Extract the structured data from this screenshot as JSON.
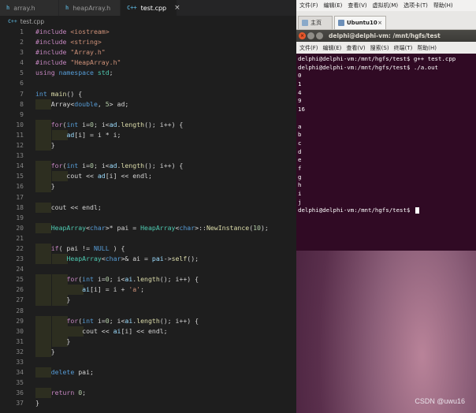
{
  "editor": {
    "tabs": [
      {
        "icon": "h",
        "label": "array.h",
        "active": false
      },
      {
        "icon": "h",
        "label": "heapArray.h",
        "active": false
      },
      {
        "icon": "C++",
        "label": "test.cpp",
        "active": true,
        "close": "×"
      }
    ],
    "breadcrumb": {
      "icon": "C++",
      "label": "test.cpp"
    },
    "line_numbers": [
      "1",
      "2",
      "3",
      "4",
      "5",
      "6",
      "7",
      "8",
      "9",
      "10",
      "11",
      "12",
      "13",
      "14",
      "15",
      "16",
      "17",
      "18",
      "19",
      "20",
      "21",
      "22",
      "23",
      "24",
      "25",
      "26",
      "27",
      "28",
      "29",
      "30",
      "31",
      "32",
      "33",
      "34",
      "35",
      "36",
      "37"
    ],
    "code": [
      [
        {
          "c": "pp",
          "t": "#include "
        },
        {
          "c": "str",
          "t": "<iostream>"
        }
      ],
      [
        {
          "c": "pp",
          "t": "#include "
        },
        {
          "c": "str",
          "t": "<string>"
        }
      ],
      [
        {
          "c": "pp",
          "t": "#include "
        },
        {
          "c": "str",
          "t": "\"Array.h\""
        }
      ],
      [
        {
          "c": "pp",
          "t": "#include "
        },
        {
          "c": "str",
          "t": "\"HeapArray.h\""
        }
      ],
      [
        {
          "c": "ctl",
          "t": "using "
        },
        {
          "c": "kw",
          "t": "namespace "
        },
        {
          "c": "ty",
          "t": "std"
        },
        {
          "c": "pl",
          "t": ";"
        }
      ],
      [],
      [
        {
          "c": "kw",
          "t": "int "
        },
        {
          "c": "fn",
          "t": "main"
        },
        {
          "c": "pl",
          "t": "() {"
        }
      ],
      [
        {
          "c": "pl",
          "t": "    Array<"
        },
        {
          "c": "kw",
          "t": "double"
        },
        {
          "c": "pl",
          "t": ", "
        },
        {
          "c": "num",
          "t": "5"
        },
        {
          "c": "pl",
          "t": "> ad;"
        }
      ],
      [],
      [
        {
          "c": "pl",
          "t": "    "
        },
        {
          "c": "ctl",
          "t": "for"
        },
        {
          "c": "pl",
          "t": "("
        },
        {
          "c": "kw",
          "t": "int "
        },
        {
          "c": "pl",
          "t": "i="
        },
        {
          "c": "num",
          "t": "0"
        },
        {
          "c": "pl",
          "t": "; i<"
        },
        {
          "c": "var",
          "t": "ad"
        },
        {
          "c": "pl",
          "t": "."
        },
        {
          "c": "fn",
          "t": "length"
        },
        {
          "c": "pl",
          "t": "(); i++) {"
        }
      ],
      [
        {
          "c": "pl",
          "t": "        "
        },
        {
          "c": "var",
          "t": "ad"
        },
        {
          "c": "pl",
          "t": "[i] = i * i;"
        }
      ],
      [
        {
          "c": "pl",
          "t": "    }"
        }
      ],
      [],
      [
        {
          "c": "pl",
          "t": "    "
        },
        {
          "c": "ctl",
          "t": "for"
        },
        {
          "c": "pl",
          "t": "("
        },
        {
          "c": "kw",
          "t": "int "
        },
        {
          "c": "pl",
          "t": "i="
        },
        {
          "c": "num",
          "t": "0"
        },
        {
          "c": "pl",
          "t": "; i<"
        },
        {
          "c": "var",
          "t": "ad"
        },
        {
          "c": "pl",
          "t": "."
        },
        {
          "c": "fn",
          "t": "length"
        },
        {
          "c": "pl",
          "t": "(); i++) {"
        }
      ],
      [
        {
          "c": "pl",
          "t": "        cout << "
        },
        {
          "c": "var",
          "t": "ad"
        },
        {
          "c": "pl",
          "t": "[i] << endl;"
        }
      ],
      [
        {
          "c": "pl",
          "t": "    }"
        }
      ],
      [],
      [
        {
          "c": "pl",
          "t": "    cout << endl;"
        }
      ],
      [],
      [
        {
          "c": "pl",
          "t": "    "
        },
        {
          "c": "ty",
          "t": "HeapArray"
        },
        {
          "c": "pl",
          "t": "<"
        },
        {
          "c": "kw",
          "t": "char"
        },
        {
          "c": "pl",
          "t": ">* pai = "
        },
        {
          "c": "ty",
          "t": "HeapArray"
        },
        {
          "c": "pl",
          "t": "<"
        },
        {
          "c": "kw",
          "t": "char"
        },
        {
          "c": "pl",
          "t": ">::"
        },
        {
          "c": "fn",
          "t": "NewInstance"
        },
        {
          "c": "pl",
          "t": "("
        },
        {
          "c": "num",
          "t": "10"
        },
        {
          "c": "pl",
          "t": ");"
        }
      ],
      [],
      [
        {
          "c": "pl",
          "t": "    "
        },
        {
          "c": "ctl",
          "t": "if"
        },
        {
          "c": "pl",
          "t": "( pai != "
        },
        {
          "c": "mac",
          "t": "NULL"
        },
        {
          "c": "pl",
          "t": " ) {"
        }
      ],
      [
        {
          "c": "pl",
          "t": "        "
        },
        {
          "c": "ty",
          "t": "HeapArray"
        },
        {
          "c": "pl",
          "t": "<"
        },
        {
          "c": "kw",
          "t": "char"
        },
        {
          "c": "pl",
          "t": ">& ai = "
        },
        {
          "c": "var",
          "t": "pai"
        },
        {
          "c": "pl",
          "t": "->"
        },
        {
          "c": "fn",
          "t": "self"
        },
        {
          "c": "pl",
          "t": "();"
        }
      ],
      [],
      [
        {
          "c": "pl",
          "t": "        "
        },
        {
          "c": "ctl",
          "t": "for"
        },
        {
          "c": "pl",
          "t": "("
        },
        {
          "c": "kw",
          "t": "int "
        },
        {
          "c": "pl",
          "t": "i="
        },
        {
          "c": "num",
          "t": "0"
        },
        {
          "c": "pl",
          "t": "; i<"
        },
        {
          "c": "var",
          "t": "ai"
        },
        {
          "c": "pl",
          "t": "."
        },
        {
          "c": "fn",
          "t": "length"
        },
        {
          "c": "pl",
          "t": "(); i++) {"
        }
      ],
      [
        {
          "c": "pl",
          "t": "            "
        },
        {
          "c": "var",
          "t": "ai"
        },
        {
          "c": "pl",
          "t": "[i] = i + "
        },
        {
          "c": "str",
          "t": "'a'"
        },
        {
          "c": "pl",
          "t": ";"
        }
      ],
      [
        {
          "c": "pl",
          "t": "        }"
        }
      ],
      [],
      [
        {
          "c": "pl",
          "t": "        "
        },
        {
          "c": "ctl",
          "t": "for"
        },
        {
          "c": "pl",
          "t": "("
        },
        {
          "c": "kw",
          "t": "int "
        },
        {
          "c": "pl",
          "t": "i="
        },
        {
          "c": "num",
          "t": "0"
        },
        {
          "c": "pl",
          "t": "; i<"
        },
        {
          "c": "var",
          "t": "ai"
        },
        {
          "c": "pl",
          "t": "."
        },
        {
          "c": "fn",
          "t": "length"
        },
        {
          "c": "pl",
          "t": "(); i++) {"
        }
      ],
      [
        {
          "c": "pl",
          "t": "            cout << "
        },
        {
          "c": "var",
          "t": "ai"
        },
        {
          "c": "pl",
          "t": "[i] << endl;"
        }
      ],
      [
        {
          "c": "pl",
          "t": "        }"
        }
      ],
      [
        {
          "c": "pl",
          "t": "    }"
        }
      ],
      [],
      [
        {
          "c": "pl",
          "t": "    "
        },
        {
          "c": "kw",
          "t": "delete "
        },
        {
          "c": "pl",
          "t": "pai;"
        }
      ],
      [],
      [
        {
          "c": "pl",
          "t": "    "
        },
        {
          "c": "ctl",
          "t": "return "
        },
        {
          "c": "num",
          "t": "0"
        },
        {
          "c": "pl",
          "t": ";"
        }
      ],
      [
        {
          "c": "pl",
          "t": "}"
        }
      ]
    ],
    "colors": {
      "keyword": "#569cd6",
      "control": "#c586c0",
      "string": "#ce9178",
      "type": "#4ec9b0",
      "function": "#dcdcaa",
      "number": "#b5cea8",
      "variable": "#9cdcfe",
      "text": "#d4d4d4"
    }
  },
  "vm": {
    "menu": [
      "文件(F)",
      "编辑(E)",
      "查看(V)",
      "虚拟机(M)",
      "选项卡(T)",
      "帮助(H)"
    ],
    "tabs": [
      {
        "label": "主页",
        "icon": "home-icon"
      },
      {
        "label": "Ubuntu10",
        "icon": "vm-icon",
        "close": "×",
        "active": true
      }
    ],
    "terminal": {
      "title": "delphi@delphi-vm: /mnt/hgfs/test",
      "close_glyph": "×",
      "menu": [
        "文件(F)",
        "编辑(E)",
        "查看(V)",
        "搜索(S)",
        "终端(T)",
        "帮助(H)"
      ],
      "lines": [
        "delphi@delphi-vm:/mnt/hgfs/test$ g++ test.cpp",
        "delphi@delphi-vm:/mnt/hgfs/test$ ./a.out",
        "0",
        "1",
        "4",
        "9",
        "16",
        "",
        "a",
        "b",
        "c",
        "d",
        "e",
        "f",
        "g",
        "h",
        "i",
        "j",
        "delphi@delphi-vm:/mnt/hgfs/test$ "
      ],
      "background": "#300a24"
    }
  },
  "watermark": "CSDN @uwu16"
}
